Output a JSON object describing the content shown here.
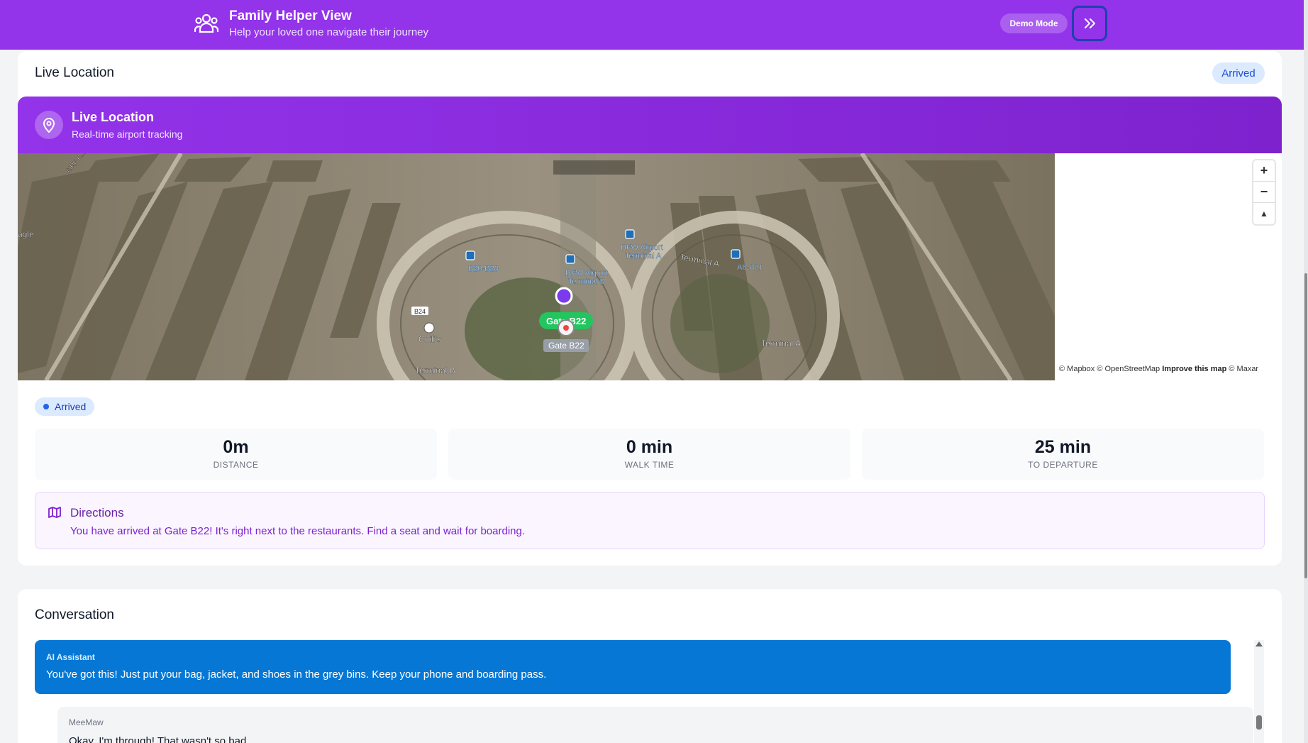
{
  "header": {
    "title": "Family Helper View",
    "subtitle": "Help your loved one navigate their journey",
    "demo_mode_label": "Demo Mode",
    "icon": "users-icon",
    "collapse_icon": "chevrons-right-icon",
    "bg_color": "#9333ea"
  },
  "live_location": {
    "card_title": "Live Location",
    "status_badge": "Arrived",
    "banner_title": "Live Location",
    "banner_subtitle": "Real-time airport tracking",
    "map": {
      "labels": {
        "gate_pill": "Gate B22",
        "gate_label": "Gate B22",
        "b20": "B20-B28",
        "dfw_b_1": "DFW Airport",
        "dfw_b_2": "Terminal B",
        "dfw_a_1": "DFW Airport",
        "dfw_a_2": "Terminal A",
        "terminal_a_top": "Terminal A",
        "a8": "A8-A21",
        "b24": "B24",
        "chilis": "Chili's",
        "terminal_b": "Terminal B",
        "terminal_a_bottom": "Terminal A",
        "eagle": "agle",
        "road": "AIRP R..."
      },
      "attribution_1": "© Mapbox © OpenStreetMap",
      "attribution_2": "Improve this map",
      "attribution_3": "© Maxar",
      "zoom_in": "+",
      "zoom_out": "−",
      "compass": "▲"
    },
    "status_pill": "Arrived",
    "stats": [
      {
        "value": "0m",
        "label": "DISTANCE"
      },
      {
        "value": "0 min",
        "label": "WALK TIME"
      },
      {
        "value": "25 min",
        "label": "TO DEPARTURE"
      }
    ],
    "directions": {
      "title": "Directions",
      "text": "You have arrived at Gate B22! It's right next to the restaurants. Find a seat and wait for boarding."
    }
  },
  "conversation": {
    "title": "Conversation",
    "messages": [
      {
        "sender": "AI Assistant",
        "text": "You've got this! Just put your bag, jacket, and shoes in the grey bins. Keep your phone and boarding pass."
      },
      {
        "sender": "MeeMaw",
        "text": "Okay, I'm through! That wasn't so bad."
      }
    ]
  }
}
